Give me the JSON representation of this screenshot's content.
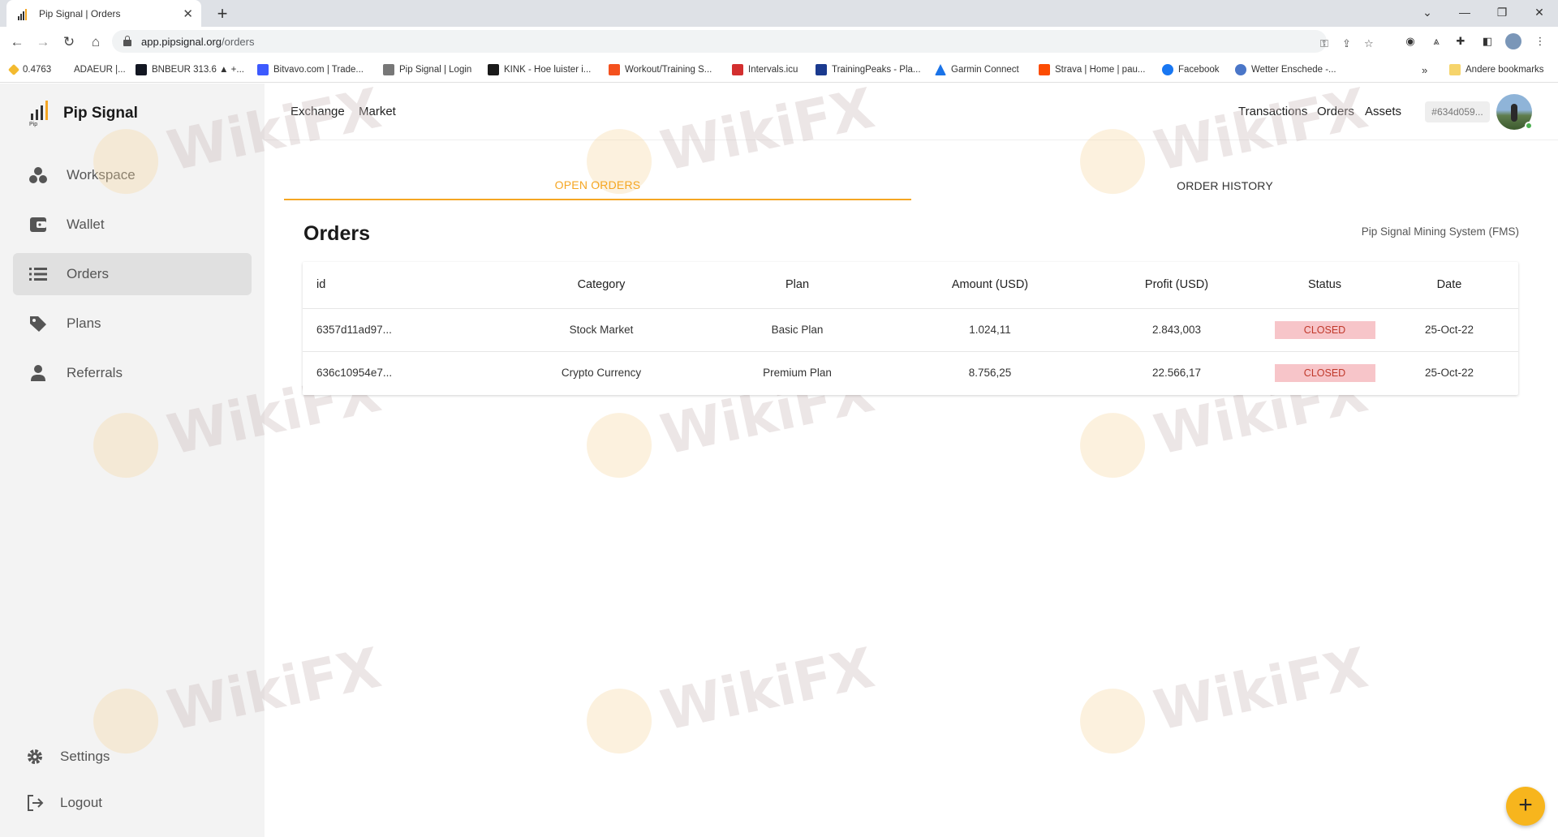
{
  "browser": {
    "tab_title": "Pip Signal | Orders",
    "url_domain": "app.pipsignal.org",
    "url_path": "/orders",
    "bookmarks": [
      {
        "label": "0.4763",
        "color": "#f3ba2f"
      },
      {
        "label": "ADAEUR |...",
        "color": ""
      },
      {
        "label": "BNBEUR 313.6 ▲ +...",
        "color": "#131722"
      },
      {
        "label": "Bitvavo.com | Trade...",
        "color": "#3d5afe"
      },
      {
        "label": "Pip Signal | Login",
        "color": "#333333"
      },
      {
        "label": "KINK - Hoe luister i...",
        "color": "#1a1a1a"
      },
      {
        "label": "Workout/Training S...",
        "color": "#f4511e"
      },
      {
        "label": "Intervals.icu",
        "color": "#d32f2f"
      },
      {
        "label": "TrainingPeaks - Pla...",
        "color": "#1a3a8f"
      },
      {
        "label": "Garmin Connect",
        "color": "#1a73e8"
      },
      {
        "label": "Strava | Home | pau...",
        "color": "#fc4c02"
      },
      {
        "label": "Facebook",
        "color": "#1877f2"
      },
      {
        "label": "Wetter Enschede -...",
        "color": "#4a76c8"
      }
    ],
    "other_bookmarks": "Andere bookmarks"
  },
  "app": {
    "brand": "Pip Signal",
    "brand_sub": "Pip",
    "sidebar": {
      "items": [
        {
          "label": "Workspace",
          "icon": "workspace-icon"
        },
        {
          "label": "Wallet",
          "icon": "wallet-icon"
        },
        {
          "label": "Orders",
          "icon": "list-icon",
          "active": true
        },
        {
          "label": "Plans",
          "icon": "tag-icon"
        },
        {
          "label": "Referrals",
          "icon": "person-icon"
        }
      ],
      "settings": "Settings",
      "logout": "Logout"
    },
    "header": {
      "left_links": [
        "Exchange",
        "Market"
      ],
      "right_links": [
        "Transactions",
        "Orders",
        "Assets"
      ],
      "account_id": "#634d059..."
    },
    "tabs": {
      "open": "OPEN ORDERS",
      "history": "ORDER HISTORY"
    },
    "page_title": "Orders",
    "system_label": "Pip Signal Mining System (FMS)",
    "table": {
      "columns": [
        "id",
        "Category",
        "Plan",
        "Amount (USD)",
        "Profit (USD)",
        "Status",
        "Date"
      ],
      "rows": [
        [
          "6357d11ad97...",
          "Stock Market",
          "Basic Plan",
          "1.024,11",
          "2.843,003",
          "CLOSED",
          "25-Oct-22"
        ],
        [
          "636c10954e7...",
          "Crypto Currency",
          "Premium Plan",
          "8.756,25",
          "22.566,17",
          "CLOSED",
          "25-Oct-22"
        ]
      ]
    },
    "fab_label": "+",
    "watermark": "WikiFX",
    "colors": {
      "accent": "#f5a623",
      "fab": "#f7b51d",
      "status_bg": "#f7c5c9",
      "status_text": "#c0392b"
    }
  }
}
